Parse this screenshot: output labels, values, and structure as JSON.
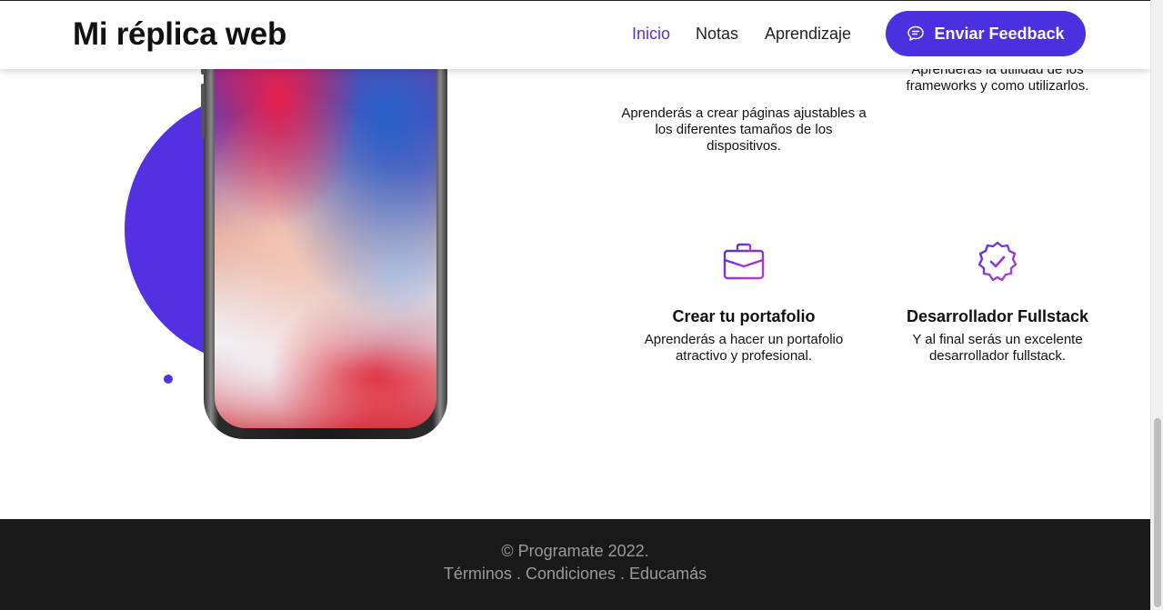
{
  "header": {
    "brand": "Mi réplica web",
    "nav": [
      {
        "label": "Inicio",
        "active": true
      },
      {
        "label": "Notas",
        "active": false
      },
      {
        "label": "Aprendizaje",
        "active": false
      }
    ],
    "feedback_button": {
      "label": "Enviar Feedback",
      "icon": "chat-bubble-icon"
    }
  },
  "hero": {
    "accent_color": "#5331e0",
    "image": "iphone-x-illustration"
  },
  "features": [
    {
      "title": "",
      "description": "Aprenderás a crear páginas ajustables a los diferentes tamaños de los dispositivos."
    },
    {
      "title": "",
      "description": "Aprenderás la utilidad de los frameworks y como utilizarlos."
    },
    {
      "title": "Crear tu portafolio",
      "description": "Aprenderás a hacer un portafolio atractivo y profesional.",
      "icon": "briefcase-icon"
    },
    {
      "title": "Desarrollador Fullstack",
      "description": "Y al final serás un excelente desarrollador fullstack.",
      "icon": "badge-check-icon"
    }
  ],
  "footer": {
    "copyright": "© Programate 2022.",
    "links": [
      "Términos",
      "Condiciones",
      "Educamás"
    ],
    "separator": " . ",
    "background": "#191919"
  },
  "colors": {
    "primary": "#4a31e0",
    "text": "#111111",
    "footer_text": "#9a9a9a"
  }
}
